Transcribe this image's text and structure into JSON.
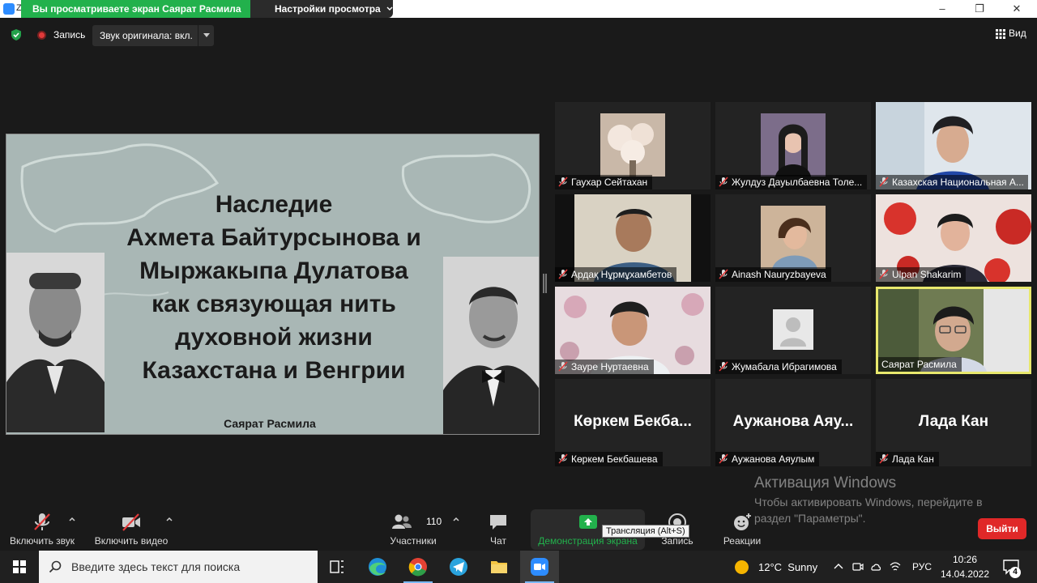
{
  "titlebar": {
    "app_letter": "Z",
    "viewing_banner": "Вы просматриваете экран Саярат Расмила",
    "view_options": "Настройки просмотра",
    "minimize": "–",
    "restore": "❐",
    "close": "✕"
  },
  "top_toolbar": {
    "recording_label": "Запись",
    "original_sound": "Звук оригинала: вкл.",
    "view_label": "Вид"
  },
  "slide": {
    "title_lines": [
      "Наследие",
      "Ахмета Байтурсынова и",
      "Мыржакыпа Дулатова",
      "как связующая нить",
      "духовной жизни",
      "Казахстана и Венгрии"
    ],
    "author": "Саярат Расмила"
  },
  "participants": [
    {
      "name": "Гаухар Сейтахан",
      "muted": true,
      "video": "flowers"
    },
    {
      "name": "Жулдуз Дауылбаевна Толе...",
      "muted": true,
      "video": "portrait"
    },
    {
      "name": "Казахская Национальная А...",
      "muted": true,
      "video": "woman-room"
    },
    {
      "name": "Ардақ Нұрмұхамбетов",
      "muted": true,
      "video": "man-room"
    },
    {
      "name": "Ainash Nauryzbayeva",
      "muted": true,
      "video": "portrait-woman"
    },
    {
      "name": "Ulpan Shakarim",
      "muted": true,
      "video": "woman-flowers"
    },
    {
      "name": "Зауре Нуртаевна",
      "muted": true,
      "video": "woman-wallpaper"
    },
    {
      "name": "Жумабала Ибрагимова",
      "muted": true,
      "video": "avatar"
    },
    {
      "name": "Саярат Расмила",
      "muted": false,
      "video": "speaker",
      "active": true
    },
    {
      "name": "Көркем Бекбашева",
      "muted": true,
      "big_name": "Көркем Бекба..."
    },
    {
      "name": "Аужанова Аяулым",
      "muted": true,
      "big_name": "Аужанова Аяу..."
    },
    {
      "name": "Лада Кан",
      "muted": true,
      "big_name": "Лада Кан"
    }
  ],
  "watermark": {
    "title": "Активация Windows",
    "line1": "Чтобы активировать Windows, перейдите в",
    "line2": "раздел \"Параметры\"."
  },
  "bottom_toolbar": {
    "audio": "Включить звук",
    "video": "Включить видео",
    "participants": "Участники",
    "participants_count": "110",
    "chat": "Чат",
    "share": "Демонстрация экрана",
    "record": "Запись",
    "reactions": "Реакции",
    "tooltip": "Трансляция (Alt+S)",
    "leave": "Выйти"
  },
  "taskbar": {
    "search_placeholder": "Введите здесь текст для поиска",
    "weather_temp": "12°C",
    "weather_cond": "Sunny",
    "language": "РУС",
    "time": "10:26",
    "date": "14.04.2022",
    "notifications": "4"
  },
  "colors": {
    "banner_green": "#22b14c",
    "leave_red": "#e02828",
    "active_speaker": "#e8e86d",
    "muted_red": "#e23a3a"
  }
}
